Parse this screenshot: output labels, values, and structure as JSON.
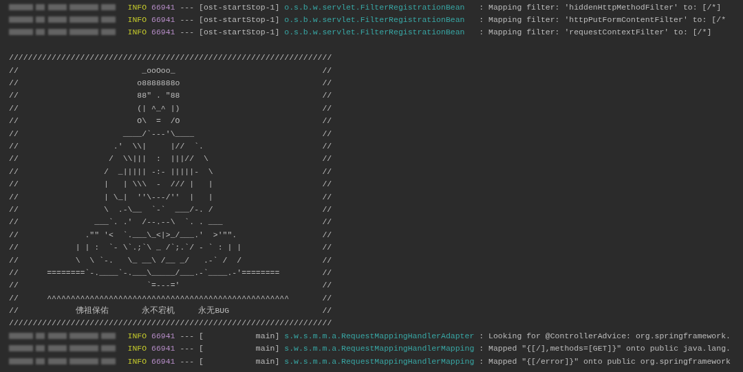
{
  "log_before": [
    {
      "level": "INFO",
      "pid": "66941",
      "separator": "---",
      "thread": "[ost-startStop-1]",
      "logger": "o.s.b.w.servlet.FilterRegistrationBean",
      "message": ": Mapping filter: 'hiddenHttpMethodFilter' to: [/*]"
    },
    {
      "level": "INFO",
      "pid": "66941",
      "separator": "---",
      "thread": "[ost-startStop-1]",
      "logger": "o.s.b.w.servlet.FilterRegistrationBean",
      "message": ": Mapping filter: 'httpPutFormContentFilter' to: [/*"
    },
    {
      "level": "INFO",
      "pid": "66941",
      "separator": "---",
      "thread": "[ost-startStop-1]",
      "logger": "o.s.b.w.servlet.FilterRegistrationBean",
      "message": ": Mapping filter: 'requestContextFilter' to: [/*]"
    }
  ],
  "banner": {
    "top": "////////////////////////////////////////////////////////////////////",
    "lines": [
      {
        "left": "//",
        "art": "                          _ooOoo_",
        "right": "//"
      },
      {
        "left": "//",
        "art": "                         o8888888o",
        "right": "//"
      },
      {
        "left": "//",
        "art": "                         88\" . \"88",
        "right": "//"
      },
      {
        "left": "//",
        "art": "                         (| ^_^ |)",
        "right": "//"
      },
      {
        "left": "//",
        "art": "                         O\\  =  /O",
        "right": "//"
      },
      {
        "left": "//",
        "art": "                      ____/`---'\\____",
        "right": "//"
      },
      {
        "left": "//",
        "art": "                    .'  \\\\|     |//  `.",
        "right": "//"
      },
      {
        "left": "//",
        "art": "                   /  \\\\|||  :  |||//  \\",
        "right": "//"
      },
      {
        "left": "//",
        "art": "                  /  _||||| -:- |||||-  \\",
        "right": "//"
      },
      {
        "left": "//",
        "art": "                  |   | \\\\\\  -  /// |   |",
        "right": "//"
      },
      {
        "left": "//",
        "art": "                  | \\_|  ''\\---/''  |   |",
        "right": "//"
      },
      {
        "left": "//",
        "art": "                  \\  .-\\__  `-`  ___/-. /",
        "right": "//"
      },
      {
        "left": "//",
        "art": "                ___`. .'  /--.--\\  `. . ___",
        "right": "//"
      },
      {
        "left": "//",
        "art": "              .\"\" '<  `.___\\_<|>_/___.'  >'\"\".",
        "right": "//"
      },
      {
        "left": "//",
        "art": "            | | :  `- \\`.;`\\ _ /`;.`/ - ` : | |",
        "right": "//"
      },
      {
        "left": "//",
        "art": "            \\  \\ `-.   \\_ __\\ /__ _/   .-` /  /",
        "right": "//"
      },
      {
        "left": "//",
        "art": "      ========`-.____`-.___\\_____/___.-`____.-'========",
        "right": "//"
      },
      {
        "left": "//",
        "art": "                           `=---='",
        "right": "//"
      },
      {
        "left": "//",
        "art": "      ^^^^^^^^^^^^^^^^^^^^^^^^^^^^^^^^^^^^^^^^^^^^^^^^^^^",
        "right": "//"
      },
      {
        "left": "//",
        "art": "            佛祖保佑       永不宕机     永无BUG",
        "right": "//"
      }
    ],
    "bottom": "////////////////////////////////////////////////////////////////////"
  },
  "log_after": [
    {
      "level": "INFO",
      "pid": "66941",
      "separator": "---",
      "thread": "[           main]",
      "logger": "s.w.s.m.m.a.RequestMappingHandlerAdapter",
      "message": ": Looking for @ControllerAdvice: org.springframework."
    },
    {
      "level": "INFO",
      "pid": "66941",
      "separator": "---",
      "thread": "[           main]",
      "logger": "s.w.s.m.m.a.RequestMappingHandlerMapping",
      "message": ": Mapped \"{[/],methods=[GET]}\" onto public java.lang."
    },
    {
      "level": "INFO",
      "pid": "66941",
      "separator": "---",
      "thread": "[           main]",
      "logger": "s.w.s.m.m.a.RequestMappingHandlerMapping",
      "message": ": Mapped \"{[/error]}\" onto public org.springframework"
    }
  ]
}
